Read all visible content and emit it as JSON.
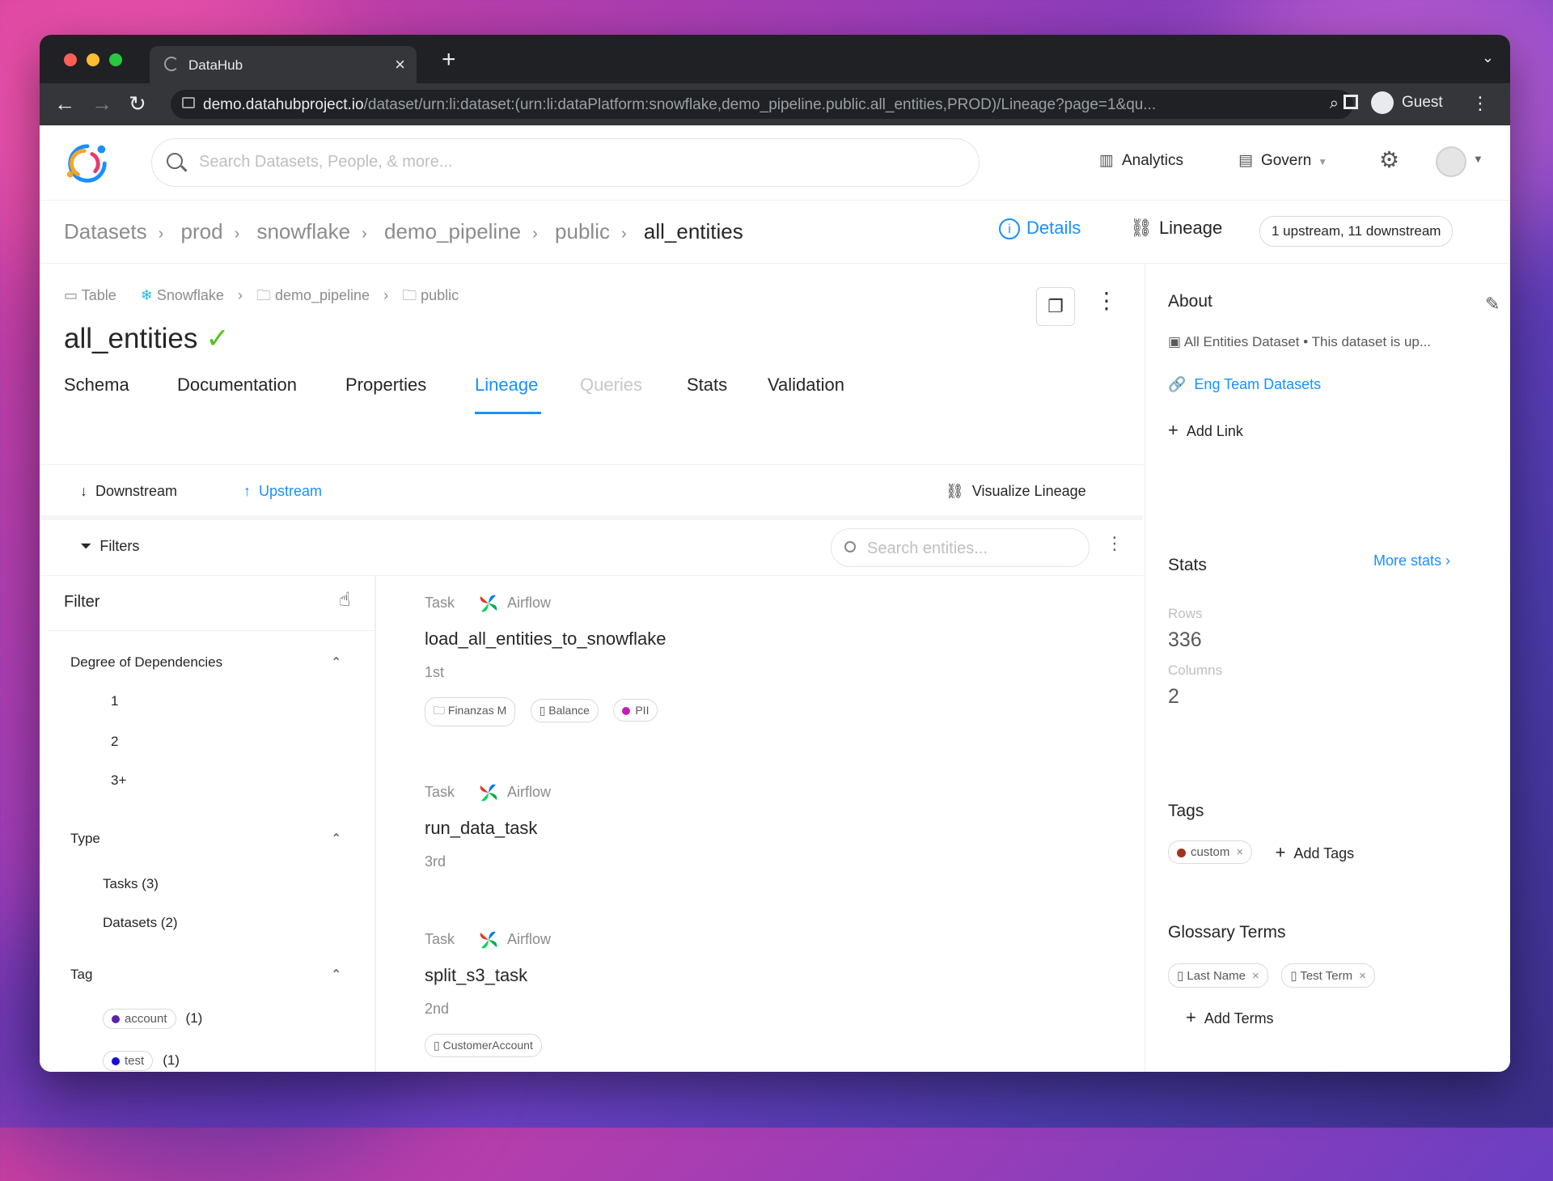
{
  "browser": {
    "tab_title": "DataHub",
    "tab_close": "×",
    "new_tab": "+",
    "url_host": "demo.datahubproject.io",
    "url_path": "/dataset/urn:li:dataset:(urn:li:dataPlatform:snowflake,demo_pipeline.public.all_entities,PROD)/Lineage?page=1&qu...",
    "profile_label": "Guest"
  },
  "header": {
    "search_placeholder": "Search Datasets, People, & more...",
    "analytics_label": "Analytics",
    "govern_label": "Govern"
  },
  "breadcrumbs": [
    "Datasets",
    "prod",
    "snowflake",
    "demo_pipeline",
    "public",
    "all_entities"
  ],
  "view_tabs": {
    "details_label": "Details",
    "lineage_label": "Lineage",
    "counts_label": "1 upstream, 11 downstream"
  },
  "entity": {
    "type": "Table",
    "platform": "Snowflake",
    "container1": "demo_pipeline",
    "container2": "public",
    "name": "all_entities",
    "verified_mark": "✓"
  },
  "tabs": [
    {
      "label": "Schema",
      "state": "normal"
    },
    {
      "label": "Documentation",
      "state": "normal"
    },
    {
      "label": "Properties",
      "state": "normal"
    },
    {
      "label": "Lineage",
      "state": "active"
    },
    {
      "label": "Queries",
      "state": "disabled"
    },
    {
      "label": "Stats",
      "state": "normal"
    },
    {
      "label": "Validation",
      "state": "normal"
    }
  ],
  "lineage": {
    "downstream_label": "Downstream",
    "upstream_label": "Upstream",
    "visualize_label": "Visualize Lineage",
    "filters_label": "Filters",
    "search_placeholder": "Search entities..."
  },
  "filter_panel": {
    "title": "Filter",
    "degree": {
      "title": "Degree of Dependencies",
      "options": [
        "1",
        "2",
        "3+"
      ]
    },
    "type": {
      "title": "Type",
      "options": [
        "Tasks (3)",
        "Datasets (2)"
      ]
    },
    "tag": {
      "title": "Tag",
      "options": [
        {
          "name": "account",
          "count": "(1)",
          "color": "#5b1fa8"
        },
        {
          "name": "test",
          "count": "(1)",
          "color": "#1a0dd6"
        }
      ]
    }
  },
  "results": [
    {
      "kind": "Task",
      "platform": "Airflow",
      "name": "load_all_entities_to_snowflake",
      "degree": "1st",
      "chips": [
        {
          "label": "Finanzas M",
          "icon": "folder-icon"
        },
        {
          "label": "Balance",
          "icon": "book-icon"
        },
        {
          "label": "PII",
          "icon": "dot",
          "color": "#c41db7"
        }
      ]
    },
    {
      "kind": "Task",
      "platform": "Airflow",
      "name": "run_data_task",
      "degree": "3rd",
      "chips": []
    },
    {
      "kind": "Task",
      "platform": "Airflow",
      "name": "split_s3_task",
      "degree": "2nd",
      "chips": [
        {
          "label": "CustomerAccount",
          "icon": "book-icon"
        }
      ]
    }
  ],
  "sidebar": {
    "about_title": "About",
    "about_text": "All Entities Dataset • This dataset is up...",
    "link_label": "Eng Team Datasets",
    "add_link_label": "Add Link",
    "stats_title": "Stats",
    "more_stats_label": "More stats ›",
    "rows_label": "Rows",
    "rows_value": "336",
    "columns_label": "Columns",
    "columns_value": "2",
    "tags_title": "Tags",
    "tag": {
      "name": "custom",
      "color": "#a3331b"
    },
    "add_tags_label": "Add Tags",
    "glossary_title": "Glossary Terms",
    "terms": [
      "Last Name",
      "Test Term"
    ],
    "add_terms_label": "Add Terms"
  },
  "colors": {
    "accent": "#1890ff",
    "verified": "#52c41a"
  }
}
